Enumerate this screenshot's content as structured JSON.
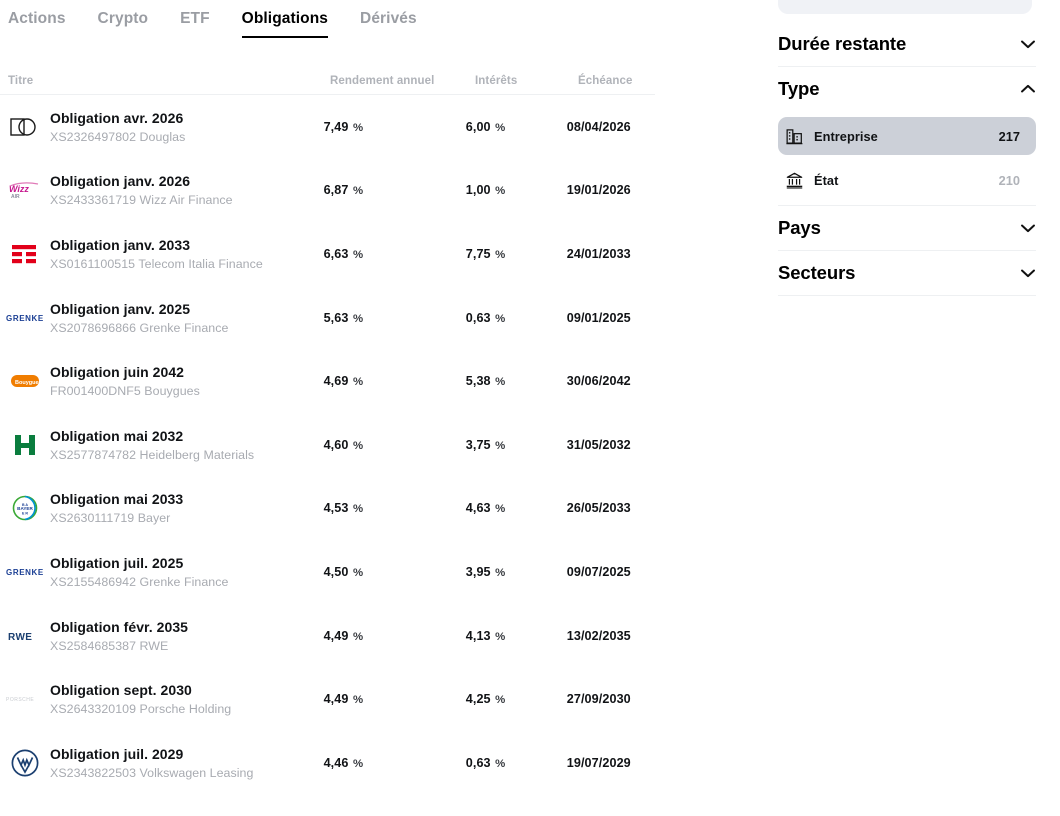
{
  "tabs": [
    {
      "label": "Actions",
      "active": false
    },
    {
      "label": "Crypto",
      "active": false
    },
    {
      "label": "ETF",
      "active": false
    },
    {
      "label": "Obligations",
      "active": true
    },
    {
      "label": "Dérivés",
      "active": false
    }
  ],
  "table": {
    "headers": {
      "title": "Titre",
      "yield": "Rendement annuel",
      "interest": "Intérêts",
      "maturity": "Échéance"
    },
    "percent_symbol": "%",
    "rows": [
      {
        "name": "Obligation avr. 2026",
        "isin_issuer": "XS2326497802 Douglas",
        "yield": "7,49",
        "interest": "6,00",
        "maturity": "08/04/2026",
        "logo": "douglas-logo"
      },
      {
        "name": "Obligation janv. 2026",
        "isin_issuer": "XS2433361719 Wizz Air Finance",
        "yield": "6,87",
        "interest": "1,00",
        "maturity": "19/01/2026",
        "logo": "wizzair-logo"
      },
      {
        "name": "Obligation janv. 2033",
        "isin_issuer": "XS0161100515 Telecom Italia Finance",
        "yield": "6,63",
        "interest": "7,75",
        "maturity": "24/01/2033",
        "logo": "tim-logo"
      },
      {
        "name": "Obligation janv. 2025",
        "isin_issuer": "XS2078696866 Grenke Finance",
        "yield": "5,63",
        "interest": "0,63",
        "maturity": "09/01/2025",
        "logo": "grenke-logo"
      },
      {
        "name": "Obligation juin 2042",
        "isin_issuer": "FR001400DNF5 Bouygues",
        "yield": "4,69",
        "interest": "5,38",
        "maturity": "30/06/2042",
        "logo": "bouygues-logo"
      },
      {
        "name": "Obligation mai 2032",
        "isin_issuer": "XS2577874782 Heidelberg Materials",
        "yield": "4,60",
        "interest": "3,75",
        "maturity": "31/05/2032",
        "logo": "heidelberg-logo"
      },
      {
        "name": "Obligation mai 2033",
        "isin_issuer": "XS2630111719 Bayer",
        "yield": "4,53",
        "interest": "4,63",
        "maturity": "26/05/2033",
        "logo": "bayer-logo"
      },
      {
        "name": "Obligation juil. 2025",
        "isin_issuer": "XS2155486942 Grenke Finance",
        "yield": "4,50",
        "interest": "3,95",
        "maturity": "09/07/2025",
        "logo": "grenke-logo"
      },
      {
        "name": "Obligation févr. 2035",
        "isin_issuer": "XS2584685387 RWE",
        "yield": "4,49",
        "interest": "4,13",
        "maturity": "13/02/2035",
        "logo": "rwe-logo"
      },
      {
        "name": "Obligation sept. 2030",
        "isin_issuer": "XS2643320109 Porsche Holding",
        "yield": "4,49",
        "interest": "4,25",
        "maturity": "27/09/2030",
        "logo": "porsche-logo"
      },
      {
        "name": "Obligation juil. 2029",
        "isin_issuer": "XS2343822503 Volkswagen Leasing",
        "yield": "4,46",
        "interest": "0,63",
        "maturity": "19/07/2029",
        "logo": "volkswagen-logo"
      }
    ]
  },
  "sidebar": {
    "filters": [
      {
        "title": "Durée restante",
        "expanded": false,
        "chevron": "chevron-down-icon"
      },
      {
        "title": "Type",
        "expanded": true,
        "chevron": "chevron-up-icon"
      },
      {
        "title": "Pays",
        "expanded": false,
        "chevron": "chevron-down-icon"
      },
      {
        "title": "Secteurs",
        "expanded": false,
        "chevron": "chevron-down-icon"
      }
    ],
    "type_options": [
      {
        "label": "Entreprise",
        "count": "217",
        "icon": "office-building-icon",
        "selected": true
      },
      {
        "label": "État",
        "count": "210",
        "icon": "bank-icon",
        "selected": false
      }
    ]
  },
  "colors": {
    "active_tab": "#000000",
    "inactive_tab": "#9a9da3",
    "muted_text": "#a8abb1",
    "selected_pill": "#ccd0d8",
    "ghost_box": "#f0f2f6"
  }
}
